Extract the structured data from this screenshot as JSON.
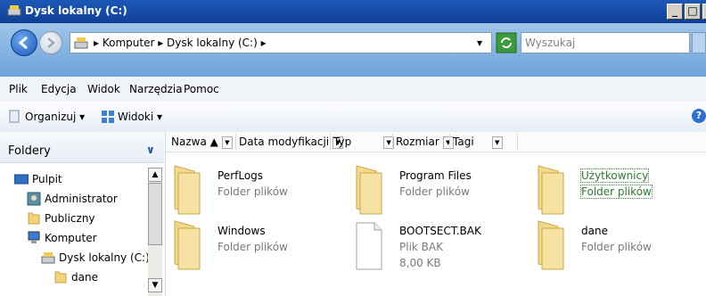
{
  "window": {
    "title": "Dysk lokalny (C:)"
  },
  "address": {
    "crumbs": [
      "▸ Komputer ▸",
      "Dysk lokalny (C:) ▸"
    ],
    "dropdown_arrow": "▾"
  },
  "search": {
    "placeholder": "Wyszukaj"
  },
  "menu": [
    "Plik",
    "Edycja",
    "Widok",
    "Narzędzia",
    "Pomoc"
  ],
  "toolbar": {
    "organize": "Organizuj ▾",
    "views": "Widoki ▾"
  },
  "sidebar": {
    "header": "Foldery",
    "items": [
      {
        "label": "Pulpit",
        "icon": "desktop-icon"
      },
      {
        "label": "Administrator",
        "icon": "user-folder-icon"
      },
      {
        "label": "Publiczny",
        "icon": "folder-icon"
      },
      {
        "label": "Komputer",
        "icon": "computer-icon"
      },
      {
        "label": "Dysk lokalny (C:)",
        "icon": "drive-icon"
      },
      {
        "label": "dane",
        "icon": "folder-icon"
      }
    ]
  },
  "columns": [
    "Nazwa",
    "Data modyfikacji",
    "Typ",
    "Rozmiar",
    "Tagi"
  ],
  "files": [
    {
      "name": "PerfLogs",
      "type": "Folder plików",
      "icon": "folder-icon"
    },
    {
      "name": "Program Files",
      "type": "Folder plików",
      "icon": "folder-icon"
    },
    {
      "name": "Użytkownicy",
      "type": "Folder plików",
      "icon": "folder-icon"
    },
    {
      "name": "Windows",
      "type": "Folder plików",
      "icon": "folder-icon"
    },
    {
      "name": "BOOTSECT.BAK",
      "type": "Plik BAK",
      "size": "8,00 KB",
      "icon": "file-icon"
    },
    {
      "name": "dane",
      "type": "Folder plików",
      "icon": "folder-icon"
    }
  ],
  "colors": {
    "title": "#1c58b8",
    "selection": "#3a9a3a"
  }
}
